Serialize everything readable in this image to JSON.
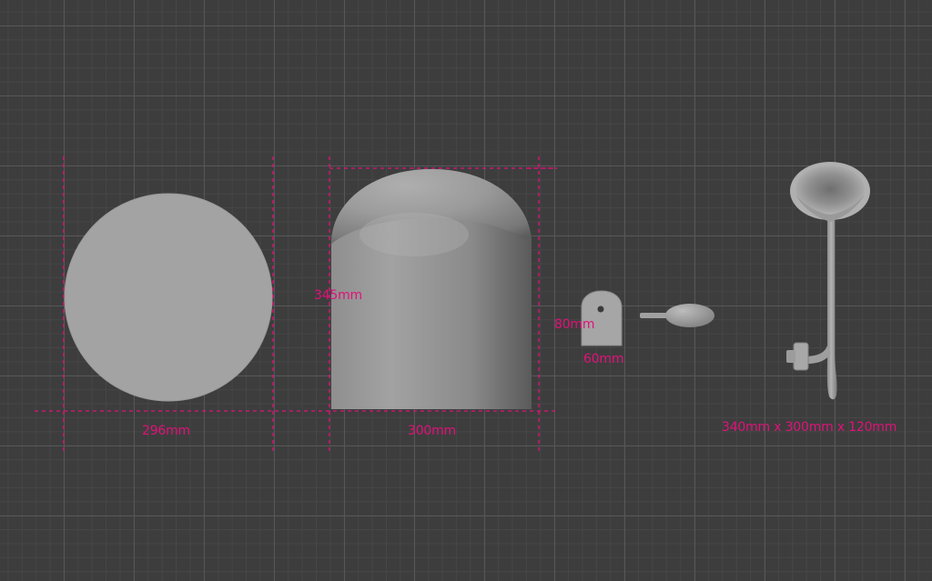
{
  "viewport": {
    "background": "#3d3d3d",
    "grid_major": "#575757",
    "grid_minor": "#464646"
  },
  "colors": {
    "accent": "#e2117a",
    "model_gray": "#a4a4a4"
  },
  "labels": {
    "disc_width": "296mm",
    "dome_height": "345mm",
    "dome_width": "300mm",
    "bracket_height": "80mm",
    "bracket_width": "60mm",
    "horn_dimensions": "340mm x 300mm x 120mm"
  },
  "objects": [
    {
      "name": "disc",
      "shape": "circle"
    },
    {
      "name": "dome",
      "shape": "dome"
    },
    {
      "name": "bracket",
      "shape": "bracket"
    },
    {
      "name": "bulb",
      "shape": "bulb"
    },
    {
      "name": "horn",
      "shape": "horn"
    }
  ]
}
